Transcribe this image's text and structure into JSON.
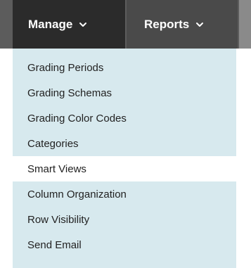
{
  "tabs": {
    "manage_label": "Manage",
    "reports_label": "Reports"
  },
  "menu": {
    "items": [
      {
        "label": "Grading Periods"
      },
      {
        "label": "Grading Schemas"
      },
      {
        "label": "Grading Color Codes"
      },
      {
        "label": "Categories"
      },
      {
        "label": "Smart Views"
      },
      {
        "label": "Column Organization"
      },
      {
        "label": "Row Visibility"
      },
      {
        "label": "Send Email"
      }
    ],
    "active_item": "Smart Views"
  },
  "colors": {
    "tab_bar": "#5c5c5c",
    "active_tab": "#2b2b2b",
    "menu_background": "#d7e9ee",
    "highlighted_item": "#ffffff"
  },
  "icons": {
    "manage_chevron": "chevron-down-icon",
    "reports_chevron": "chevron-down-icon"
  }
}
